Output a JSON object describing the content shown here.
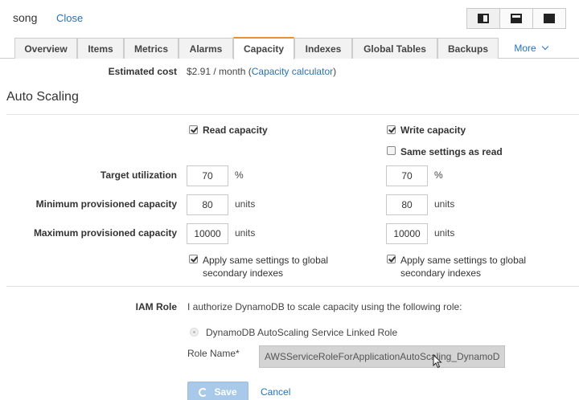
{
  "header": {
    "table_name": "song",
    "close_label": "Close"
  },
  "layout_buttons": [
    {
      "name": "split-left-icon"
    },
    {
      "name": "split-bottom-icon"
    },
    {
      "name": "full-screen-icon"
    }
  ],
  "tabs": [
    {
      "label": "Overview"
    },
    {
      "label": "Items"
    },
    {
      "label": "Metrics"
    },
    {
      "label": "Alarms"
    },
    {
      "label": "Capacity",
      "active": true
    },
    {
      "label": "Indexes"
    },
    {
      "label": "Global Tables"
    },
    {
      "label": "Backups"
    },
    {
      "label": "More"
    }
  ],
  "estimated_cost": {
    "label": "Estimated cost",
    "value": "$2.91 / month",
    "paren_open": "(",
    "calculator_link": "Capacity calculator",
    "paren_close": ")"
  },
  "auto_scaling": {
    "title": "Auto Scaling",
    "read_capacity_label": "Read capacity",
    "write_capacity_label": "Write capacity",
    "same_settings_label": "Same settings as read",
    "target_utilization_label": "Target utilization",
    "min_capacity_label": "Minimum provisioned capacity",
    "max_capacity_label": "Maximum provisioned capacity",
    "percent_unit": "%",
    "units_unit": "units",
    "read": {
      "target": "70",
      "min": "80",
      "max": "10000"
    },
    "write": {
      "target": "70",
      "min": "80",
      "max": "10000"
    },
    "apply_gsi_line1": "Apply same settings to global",
    "apply_gsi_line2": "secondary indexes"
  },
  "iam": {
    "label": "IAM Role",
    "description": "I authorize DynamoDB to scale capacity using the following role:",
    "option_label": "DynamoDB AutoScaling Service Linked Role",
    "role_name_label": "Role Name*",
    "role_name_value": "AWSServiceRoleForApplicationAutoScaling_DynamoDB"
  },
  "actions": {
    "save_label": "Save",
    "cancel_label": "Cancel"
  }
}
